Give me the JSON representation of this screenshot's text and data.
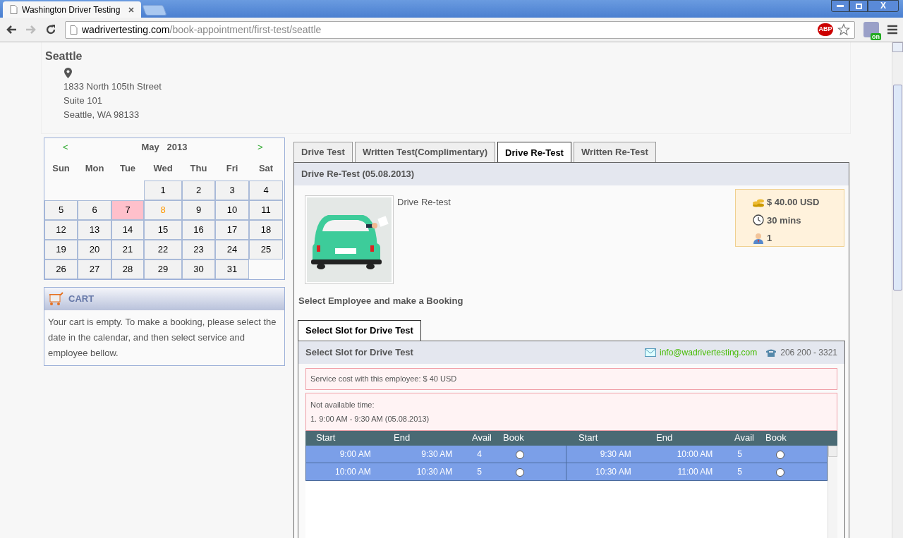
{
  "browser": {
    "tab_title": "Washington Driver Testing",
    "url_host": "wadrivertesting.com",
    "url_path": "/book-appointment/first-test/seattle",
    "window_controls": {
      "close": "X"
    },
    "extension_badge": "on",
    "adblock_label": "ABP"
  },
  "location": {
    "name": "Seattle",
    "address": [
      "1833 North 105th Street",
      "Suite 101",
      "Seattle, WA 98133"
    ]
  },
  "calendar": {
    "prev": "<",
    "next": ">",
    "month": "May",
    "year": "2013",
    "weekdays": [
      "Sun",
      "Mon",
      "Tue",
      "Wed",
      "Thu",
      "Fri",
      "Sat"
    ],
    "weeks": [
      [
        {
          "kind": "blank"
        },
        {
          "kind": "blank"
        },
        {
          "kind": "blank"
        },
        {
          "kind": "day",
          "label": "1",
          "selected": false,
          "today": false
        },
        {
          "kind": "day",
          "label": "2",
          "selected": false,
          "today": false
        },
        {
          "kind": "day",
          "label": "3",
          "selected": false,
          "today": false
        },
        {
          "kind": "day",
          "label": "4",
          "selected": false,
          "today": false
        }
      ],
      [
        {
          "kind": "day",
          "label": "5",
          "selected": false,
          "today": false
        },
        {
          "kind": "day",
          "label": "6",
          "selected": false,
          "today": false
        },
        {
          "kind": "day",
          "label": "7",
          "selected": true,
          "today": false
        },
        {
          "kind": "day",
          "label": "8",
          "selected": false,
          "today": true
        },
        {
          "kind": "day",
          "label": "9",
          "selected": false,
          "today": false
        },
        {
          "kind": "day",
          "label": "10",
          "selected": false,
          "today": false
        },
        {
          "kind": "day",
          "label": "11",
          "selected": false,
          "today": false
        }
      ],
      [
        {
          "kind": "day",
          "label": "12",
          "selected": false,
          "today": false
        },
        {
          "kind": "day",
          "label": "13",
          "selected": false,
          "today": false
        },
        {
          "kind": "day",
          "label": "14",
          "selected": false,
          "today": false
        },
        {
          "kind": "day",
          "label": "15",
          "selected": false,
          "today": false
        },
        {
          "kind": "day",
          "label": "16",
          "selected": false,
          "today": false
        },
        {
          "kind": "day",
          "label": "17",
          "selected": false,
          "today": false
        },
        {
          "kind": "day",
          "label": "18",
          "selected": false,
          "today": false
        }
      ],
      [
        {
          "kind": "day",
          "label": "19",
          "selected": false,
          "today": false
        },
        {
          "kind": "day",
          "label": "20",
          "selected": false,
          "today": false
        },
        {
          "kind": "day",
          "label": "21",
          "selected": false,
          "today": false
        },
        {
          "kind": "day",
          "label": "22",
          "selected": false,
          "today": false
        },
        {
          "kind": "day",
          "label": "23",
          "selected": false,
          "today": false
        },
        {
          "kind": "day",
          "label": "24",
          "selected": false,
          "today": false
        },
        {
          "kind": "day",
          "label": "25",
          "selected": false,
          "today": false
        }
      ],
      [
        {
          "kind": "day",
          "label": "26",
          "selected": false,
          "today": false
        },
        {
          "kind": "day",
          "label": "27",
          "selected": false,
          "today": false
        },
        {
          "kind": "day",
          "label": "28",
          "selected": false,
          "today": false
        },
        {
          "kind": "day",
          "label": "29",
          "selected": false,
          "today": false
        },
        {
          "kind": "day",
          "label": "30",
          "selected": false,
          "today": false
        },
        {
          "kind": "day",
          "label": "31",
          "selected": false,
          "today": false
        },
        {
          "kind": "blank"
        }
      ]
    ]
  },
  "cart": {
    "title": "CART",
    "message": "Your cart is empty. To make a booking, please select the date in the calendar, and then select service and employee bellow."
  },
  "service_tabs": [
    {
      "label": "Drive Test",
      "selected": false
    },
    {
      "label": "Written Test(Complimentary)",
      "selected": false
    },
    {
      "label": "Drive Re-Test",
      "selected": true
    },
    {
      "label": "Written Re-Test",
      "selected": false
    }
  ],
  "service": {
    "heading": "Drive Re-Test (05.08.2013)",
    "description": "Drive Re-test",
    "price": "$ 40.00 USD",
    "duration": "30 mins",
    "capacity": "1"
  },
  "employee_prompt": "Select Employee and make a Booking",
  "employee_tabs": [
    {
      "label": "Select Slot for Drive Test",
      "selected": true
    }
  ],
  "slots_panel": {
    "heading": "Select Slot for Drive Test",
    "email": "info@wadrivertesting.com",
    "phone": "206 200 - 3321",
    "cost_note": "Service cost with this employee: $ 40 USD",
    "unavailable_title": "Not available time:",
    "unavailable": [
      "1. 9:00 AM - 9:30 AM (05.08.2013)"
    ],
    "columns": [
      "Start",
      "End",
      "Avail",
      "Book",
      "Start",
      "End",
      "Avail",
      "Book"
    ],
    "rows": [
      [
        "9:00 AM",
        "9:30 AM",
        "4",
        {
          "kind": "radio",
          "selected": false
        },
        "9:30 AM",
        "10:00 AM",
        "5",
        {
          "kind": "radio",
          "selected": false
        }
      ],
      [
        "10:00 AM",
        "10:30 AM",
        "5",
        {
          "kind": "radio",
          "selected": false
        },
        "10:30 AM",
        "11:00 AM",
        "5",
        {
          "kind": "radio",
          "selected": false
        }
      ]
    ]
  }
}
